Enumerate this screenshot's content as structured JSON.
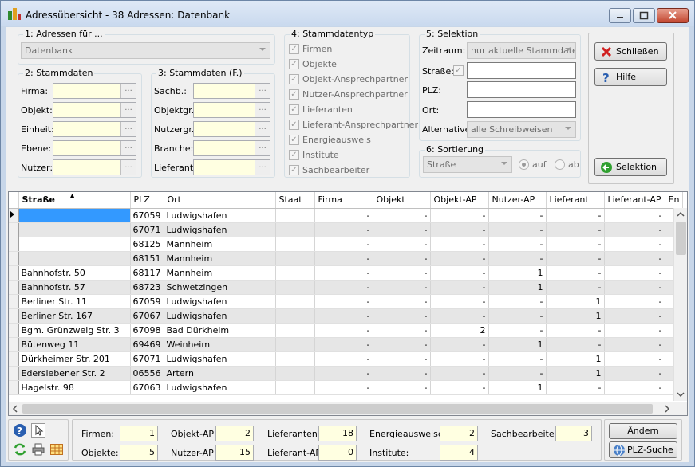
{
  "window": {
    "title": "Adressübersicht - 38 Adressen:  Datenbank"
  },
  "group1": {
    "legend": "1: Adressen für ...",
    "combo_value": "Datenbank"
  },
  "group2": {
    "legend": "2: Stammdaten",
    "labels": [
      "Firma:",
      "Objekt:",
      "Einheit:",
      "Ebene:",
      "Nutzer:"
    ]
  },
  "group3": {
    "legend": "3: Stammdaten (F.)",
    "labels": [
      "Sachb.:",
      "Objektgr.:",
      "Nutzergr.:",
      "Branche:",
      "Lieferant:"
    ]
  },
  "group4": {
    "legend": "4: Stammdatentyp",
    "items": [
      "Firmen",
      "Objekte",
      "Objekt-Ansprechpartner",
      "Nutzer-Ansprechpartner",
      "Lieferanten",
      "Lieferant-Ansprechpartner",
      "Energieausweis",
      "Institute",
      "Sachbearbeiter"
    ]
  },
  "group5": {
    "legend": "5: Selektion",
    "zeitraum_label": "Zeitraum:",
    "zeitraum_value": "nur aktuelle Stammdaten",
    "strasse_label": "Straße:",
    "plz_label": "PLZ:",
    "ort_label": "Ort:",
    "alternative_label": "Alternative:",
    "alternative_value": "alle Schreibweisen"
  },
  "group6": {
    "legend": "6: Sortierung",
    "combo_value": "Straße",
    "radio_auf": "auf",
    "radio_ab": "ab"
  },
  "buttons": {
    "close": "Schließen",
    "help": "Hilfe",
    "selection": "Selektion",
    "change": "Ändern",
    "plz_search": "PLZ-Suche",
    "icon_button_count_note": ""
  },
  "grid": {
    "columns": [
      "Straße",
      "PLZ",
      "Ort",
      "Staat",
      "Firma",
      "Objekt",
      "Objekt-AP",
      "Nutzer-AP",
      "Lieferant",
      "Lieferant-AP",
      "En"
    ],
    "rows": [
      [
        "",
        "67059",
        "Ludwigshafen",
        "",
        "-",
        "-",
        "-",
        "-",
        "-",
        "-"
      ],
      [
        "",
        "67071",
        "Ludwigshafen",
        "",
        "-",
        "-",
        "-",
        "-",
        "-",
        "-"
      ],
      [
        "",
        "68125",
        "Mannheim",
        "",
        "-",
        "-",
        "-",
        "-",
        "-",
        "-"
      ],
      [
        "",
        "68151",
        "Mannheim",
        "",
        "-",
        "-",
        "-",
        "-",
        "-",
        "-"
      ],
      [
        "Bahnhofstr. 50",
        "68117",
        "Mannheim",
        "",
        "-",
        "-",
        "-",
        "1",
        "-",
        "-"
      ],
      [
        "Bahnhofstr. 57",
        "68723",
        "Schwetzingen",
        "",
        "-",
        "-",
        "-",
        "1",
        "-",
        "-"
      ],
      [
        "Berliner Str. 11",
        "67059",
        "Ludwigshafen",
        "",
        "-",
        "-",
        "-",
        "-",
        "1",
        "-"
      ],
      [
        "Berliner Str. 167",
        "67067",
        "Ludwigshafen",
        "",
        "-",
        "-",
        "-",
        "-",
        "1",
        "-"
      ],
      [
        "Bgm. Grünzweig Str. 3",
        "67098",
        "Bad Dürkheim",
        "",
        "-",
        "-",
        "2",
        "-",
        "-",
        "-"
      ],
      [
        "Bütenweg 11",
        "69469",
        "Weinheim",
        "",
        "-",
        "-",
        "-",
        "1",
        "-",
        "-"
      ],
      [
        "Dürkheimer Str. 201",
        "67071",
        "Ludwigshafen",
        "",
        "-",
        "-",
        "-",
        "-",
        "1",
        "-"
      ],
      [
        "Ederslebener Str. 2",
        "06556",
        "Artern",
        "",
        "-",
        "-",
        "-",
        "-",
        "1",
        "-"
      ],
      [
        "Hagelstr. 98",
        "67063",
        "Ludwigshafen",
        "",
        "-",
        "-",
        "-",
        "1",
        "-",
        "-"
      ]
    ]
  },
  "summary": {
    "firmen_label": "Firmen:",
    "firmen": "1",
    "objekte_label": "Objekte:",
    "objekte": "5",
    "objektap_label": "Objekt-AP:",
    "objektap": "2",
    "nutzerap_label": "Nutzer-AP:",
    "nutzerap": "15",
    "lieferanten_label": "Lieferanten:",
    "lieferanten": "18",
    "lieferantap_label": "Lieferant-AP:",
    "lieferantap": "0",
    "energie_label": "Energieausweise:",
    "energie": "2",
    "institute_label": "Institute:",
    "institute": "4",
    "sachb_label": "Sachbearbeiter:",
    "sachb": "3"
  },
  "colors": {
    "title_bg": "#c9d9ee",
    "field_yellow": "#ffffe1",
    "selection_blue": "#3399ff",
    "alt_row": "#e6e6e6"
  }
}
